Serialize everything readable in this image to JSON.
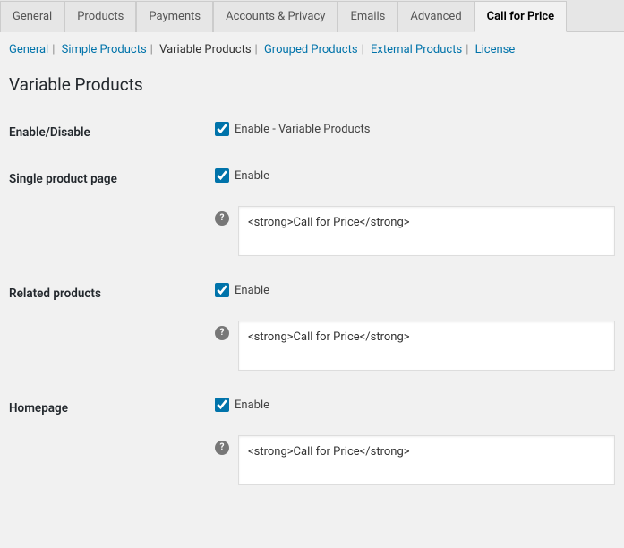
{
  "tabs": {
    "general": "General",
    "products": "Products",
    "payments": "Payments",
    "accounts": "Accounts & Privacy",
    "emails": "Emails",
    "advanced": "Advanced",
    "call_for_price": "Call for Price"
  },
  "subtabs": {
    "general": "General",
    "simple": "Simple Products",
    "variable": "Variable Products",
    "grouped": "Grouped Products",
    "external": "External Products",
    "license": "License"
  },
  "heading": "Variable Products",
  "rows": {
    "enable": {
      "label": "Enable/Disable",
      "cb": "Enable - Variable Products"
    },
    "single": {
      "label": "Single product page",
      "cb": "Enable",
      "text": "<strong>Call for Price</strong>"
    },
    "related": {
      "label": "Related products",
      "cb": "Enable",
      "text": "<strong>Call for Price</strong>"
    },
    "home": {
      "label": "Homepage",
      "cb": "Enable",
      "text": "<strong>Call for Price</strong>"
    }
  },
  "help_glyph": "?"
}
